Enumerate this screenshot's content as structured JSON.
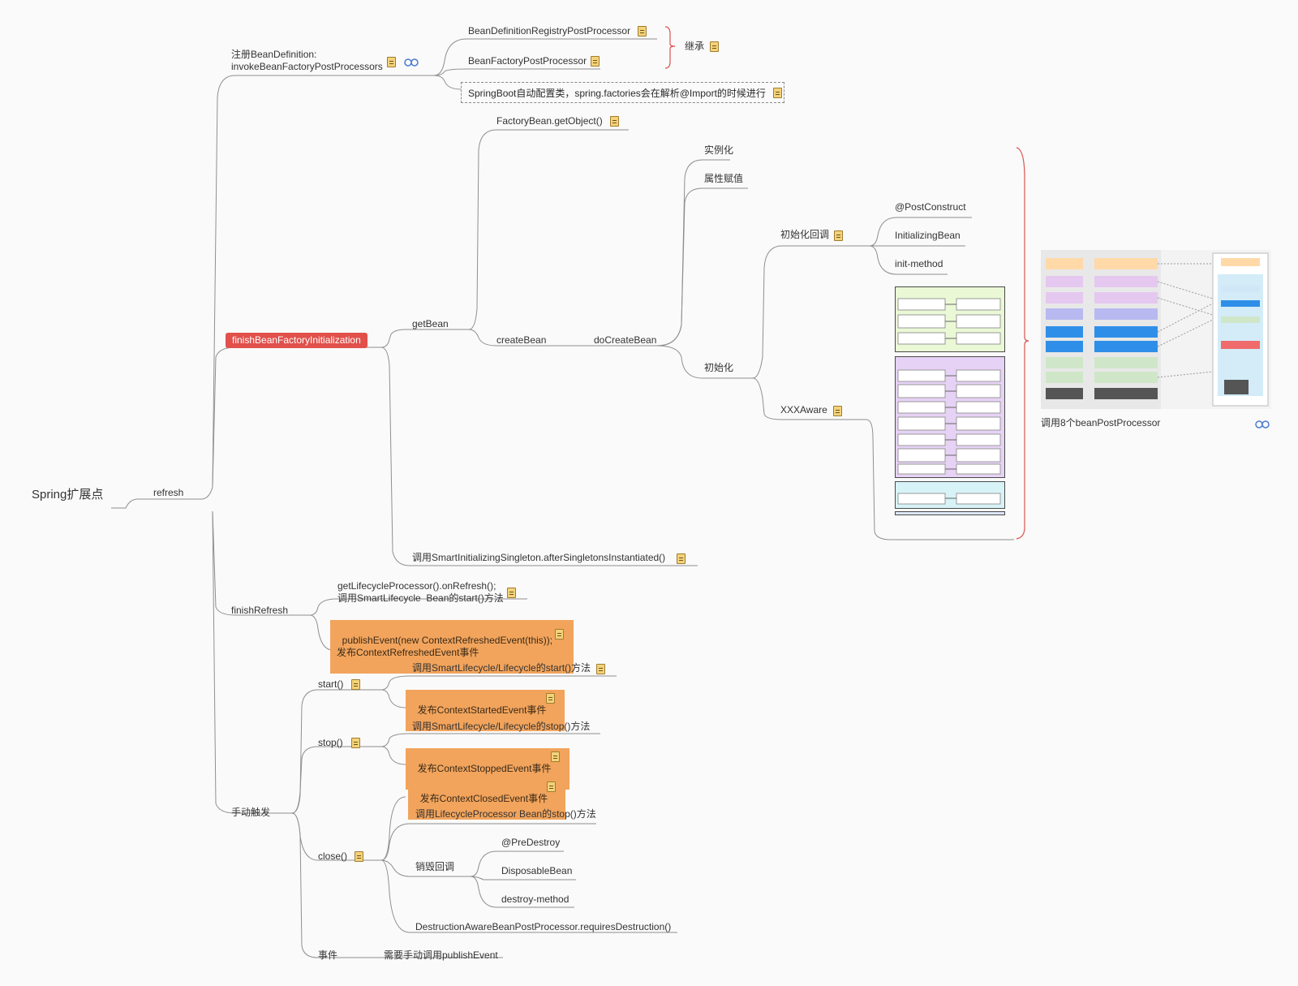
{
  "root": "Spring扩展点",
  "refresh": "refresh",
  "register": {
    "label": "注册BeanDefinition:\ninvokeBeanFactoryPostProcessors",
    "registry_pp": "BeanDefinitionRegistryPostProcessor",
    "factory_pp": "BeanFactoryPostProcessor",
    "inherit": "继承",
    "springboot": "SpringBoot自动配置类，spring.factories会在解析@Import的时候进行"
  },
  "finish_bf": {
    "label": "finishBeanFactoryInitialization",
    "factory_bean": "FactoryBean.getObject()",
    "get_bean": "getBean",
    "create_bean": "createBean",
    "do_create_bean": "doCreateBean",
    "instantiate": "实例化",
    "populate": "属性赋值",
    "initialize": "初始化",
    "init_callback": "初始化回调",
    "post_construct": "@PostConstruct",
    "initializing_bean": "InitializingBean",
    "init_method": "init-method",
    "xxx_aware": "XXXAware",
    "smart_singleton": "调用SmartInitializingSingleton.afterSingletonsInstantiated()",
    "bpp_caption": "调用8个beanPostProcessor"
  },
  "finish_refresh": {
    "label": "finishRefresh",
    "lifecycle": "getLifecycleProcessor().onRefresh();\n调用SmartLifecycle  Bean的start()方法",
    "publish": "publishEvent(new ContextRefreshedEvent(this));\n发布ContextRefreshedEvent事件"
  },
  "manual": {
    "label": "手动触发",
    "start": "start()",
    "start_call": "调用SmartLifecycle/Lifecycle的start()方法",
    "start_event": "发布ContextStartedEvent事件",
    "stop": "stop()",
    "stop_call": "调用SmartLifecycle/Lifecycle的stop()方法",
    "stop_event": "发布ContextStoppedEvent事件",
    "close": "close()",
    "close_event": "发布ContextClosedEvent事件",
    "close_lifecycle": "调用LifecycleProcessor Bean的stop()方法",
    "destroy_callback": "销毁回调",
    "pre_destroy": "@PreDestroy",
    "disposable": "DisposableBean",
    "destroy_method": "destroy-method",
    "destruction_aware": "DestructionAwareBeanPostProcessor.requiresDestruction()",
    "event": "事件",
    "event_desc": "需要手动调用publishEvent"
  },
  "colors": {
    "line": "#8a8a8a",
    "accent_red": "#e1504b",
    "orange_box": "#f2a45c",
    "note_icon": "#f4d27a",
    "brace": "#d9534f",
    "link": "#4a7bd0"
  }
}
